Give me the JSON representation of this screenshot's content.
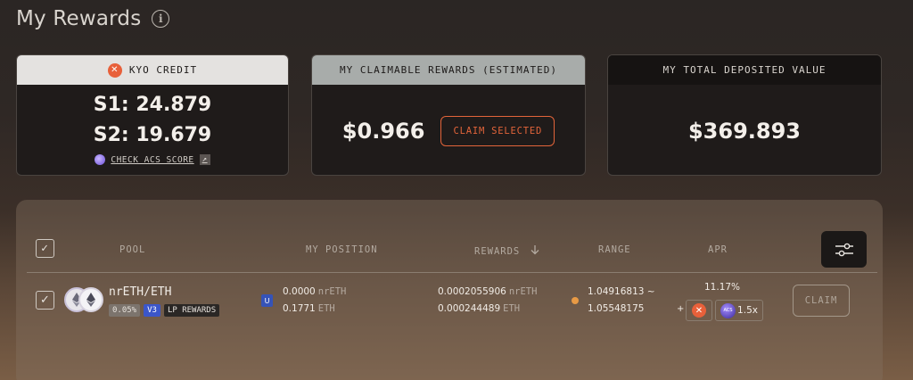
{
  "header": {
    "title": "My Rewards",
    "info_icon": "info-icon"
  },
  "kyo_credit": {
    "title": "KYO CREDIT",
    "s1": "S1: 24.879",
    "s2": "S2: 19.679",
    "link": "CHECK ACS SCORE"
  },
  "claimable": {
    "title": "MY CLAIMABLE REWARDS (ESTIMATED)",
    "value": "$0.966",
    "button": "CLAIM SELECTED"
  },
  "deposited": {
    "title": "MY TOTAL DEPOSITED VALUE",
    "value": "$369.893"
  },
  "table": {
    "columns": [
      "POOL",
      "MY POSITION",
      "REWARDS",
      "RANGE",
      "APR"
    ],
    "sort_icon": "arrow-down-icon",
    "rows": [
      {
        "pair": "nrETH/ETH",
        "fee": "0.05%",
        "version": "V3",
        "type": "LP REWARDS",
        "position_badge": "U",
        "position": [
          {
            "amount": "0.0000",
            "unit": "nrETH"
          },
          {
            "amount": "0.1771",
            "unit": "ETH"
          }
        ],
        "rewards": [
          {
            "amount": "0.0002055906",
            "unit": "nrETH"
          },
          {
            "amount": "0.000244489",
            "unit": "ETH"
          }
        ],
        "range_low": "1.04916813 ~",
        "range_high": "1.05548175",
        "apr": "11.17%",
        "apr_plus": "+",
        "boost": "1.5x",
        "acs_label": "ACS",
        "claim": "CLAIM"
      }
    ]
  },
  "colors": {
    "accent": "#e2643a",
    "v3_badge": "#3b56c9",
    "range_dot": "#e89a45"
  }
}
